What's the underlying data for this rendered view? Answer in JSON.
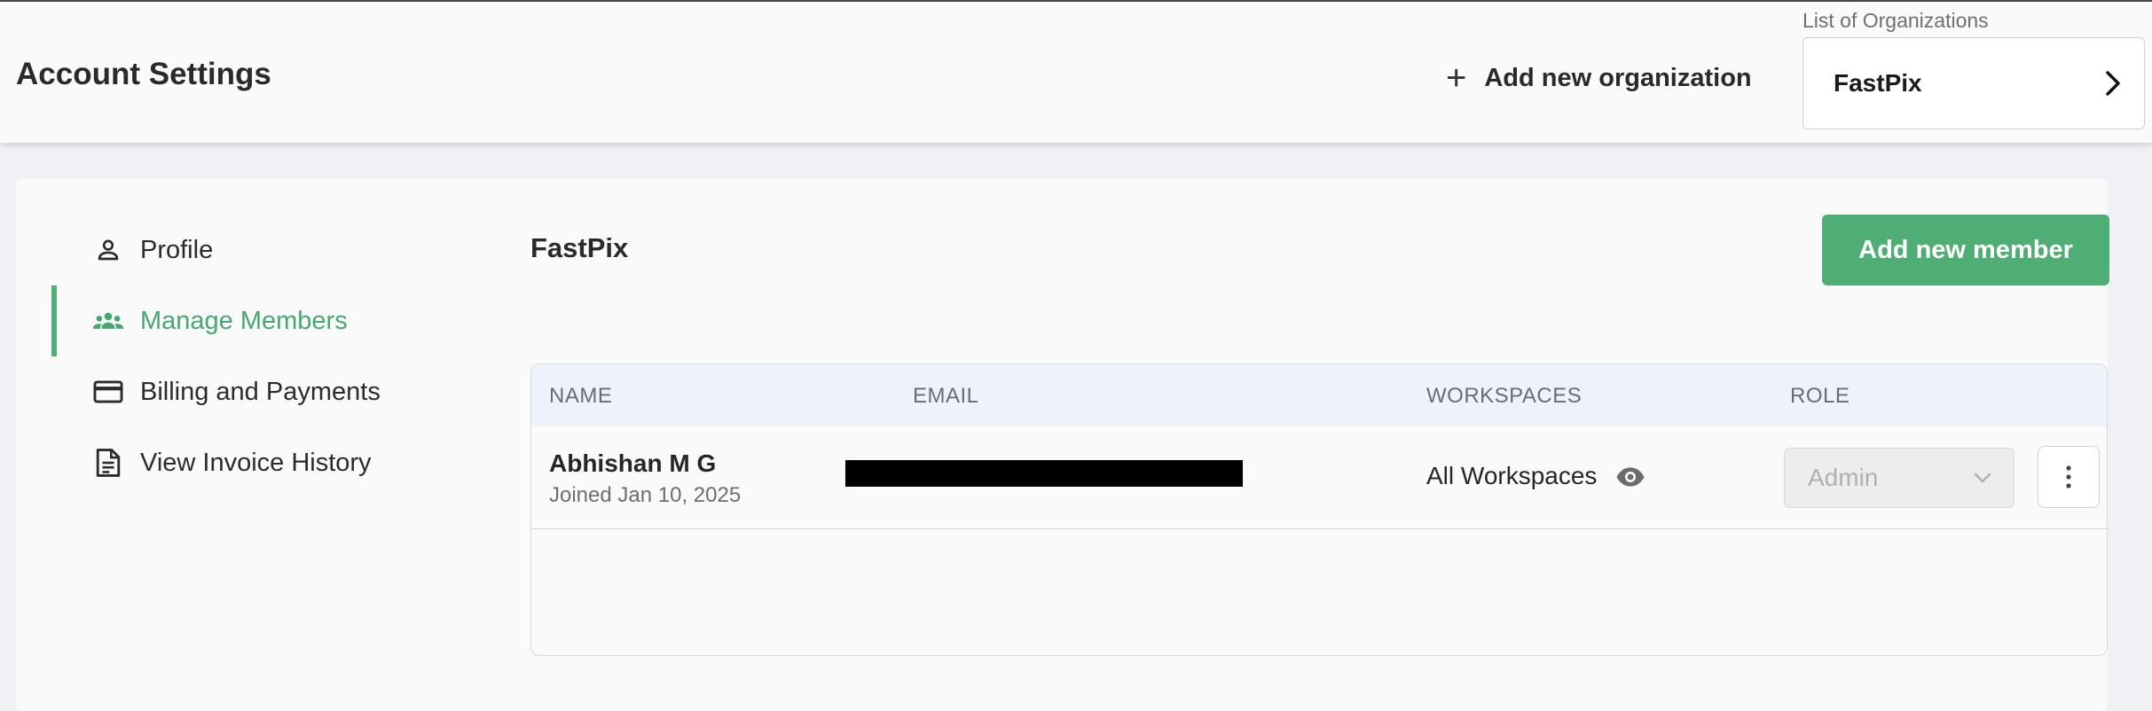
{
  "header": {
    "title": "Account Settings",
    "add_org_label": "Add new organization",
    "org_caption": "List of Organizations",
    "org_selected": "FastPix"
  },
  "sidebar": {
    "items": [
      {
        "label": "Profile",
        "icon": "person-icon",
        "active": false
      },
      {
        "label": "Manage Members",
        "icon": "group-icon",
        "active": true
      },
      {
        "label": "Billing and Payments",
        "icon": "credit-card-icon",
        "active": false
      },
      {
        "label": "View Invoice History",
        "icon": "document-icon",
        "active": false
      }
    ]
  },
  "main": {
    "title": "FastPix",
    "add_member_label": "Add new member",
    "table": {
      "columns": [
        "NAME",
        "EMAIL",
        "WORKSPACES",
        "ROLE"
      ],
      "rows": [
        {
          "name": "Abhishan M G",
          "joined": "Joined Jan 10, 2025",
          "email": "",
          "workspaces": "All Workspaces",
          "role": "Admin"
        }
      ]
    }
  },
  "colors": {
    "accent": "#4fae74",
    "header_bg": "#eef3fb"
  }
}
